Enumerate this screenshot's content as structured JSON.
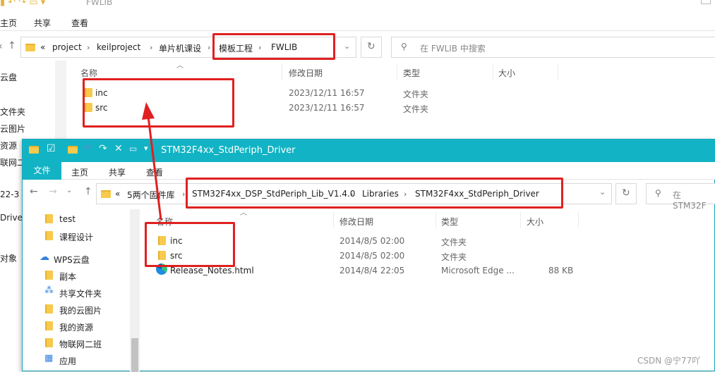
{
  "back": {
    "title": "FWLIB",
    "tabs": {
      "file": "主页",
      "share": "共享",
      "view": "查看"
    },
    "breadcrumb": {
      "overflow": "«",
      "items": [
        "project",
        "keilproject",
        "单片机课设",
        "模板工程",
        "FWLIB"
      ]
    },
    "search_placeholder": "在 FWLIB 中搜索",
    "columns": {
      "name": "名称",
      "date": "修改日期",
      "type": "类型",
      "size": "大小"
    },
    "rows": [
      {
        "name": "inc",
        "date": "2023/12/11 16:57",
        "type": "文件夹",
        "size": ""
      },
      {
        "name": "src",
        "date": "2023/12/11 16:57",
        "type": "文件夹",
        "size": ""
      }
    ],
    "sidebar": [
      "云盘",
      "",
      "文件夹",
      "云图片",
      "资源",
      "联网二班",
      "22-3",
      "Drive",
      "",
      "对象",
      "",
      "",
      "",
      "",
      ""
    ]
  },
  "front": {
    "title": "STM32F4xx_StdPeriph_Driver",
    "tabs": {
      "file": "文件",
      "home": "主页",
      "share": "共享",
      "view": "查看"
    },
    "breadcrumb": {
      "overflow": "«",
      "items": [
        "5两个固件库",
        "STM32F4xx_DSP_StdPeriph_Lib_V1.4.0",
        "Libraries",
        "STM32F4xx_StdPeriph_Driver"
      ]
    },
    "search_placeholder": "在 STM32F",
    "columns": {
      "name": "名称",
      "date": "修改日期",
      "type": "类型",
      "size": "大小"
    },
    "rows": [
      {
        "name": "inc",
        "date": "2014/8/5 02:00",
        "type": "文件夹",
        "size": ""
      },
      {
        "name": "src",
        "date": "2014/8/5 02:00",
        "type": "文件夹",
        "size": ""
      },
      {
        "name": "Release_Notes.html",
        "date": "2014/8/4 22:05",
        "type": "Microsoft Edge ...",
        "size": "88 KB"
      }
    ],
    "sidebar": [
      {
        "label": "test",
        "icon": "folder-icon"
      },
      {
        "label": "课程设计",
        "icon": "folder-icon"
      },
      {
        "label": "WPS云盘",
        "icon": "cloud-icon"
      },
      {
        "label": "副本",
        "icon": "folder-icon"
      },
      {
        "label": "共享文件夹",
        "icon": "share-icon"
      },
      {
        "label": "我的云图片",
        "icon": "folder-icon"
      },
      {
        "label": "我的资源",
        "icon": "folder-icon"
      },
      {
        "label": "物联网二班",
        "icon": "folder-icon"
      },
      {
        "label": "应用",
        "icon": "apps-icon"
      }
    ]
  },
  "watermark": "CSDN @宁77吖",
  "colors": {
    "accent": "#12b3c4",
    "highlight": "#e02020",
    "folder": "#f7c94c"
  }
}
